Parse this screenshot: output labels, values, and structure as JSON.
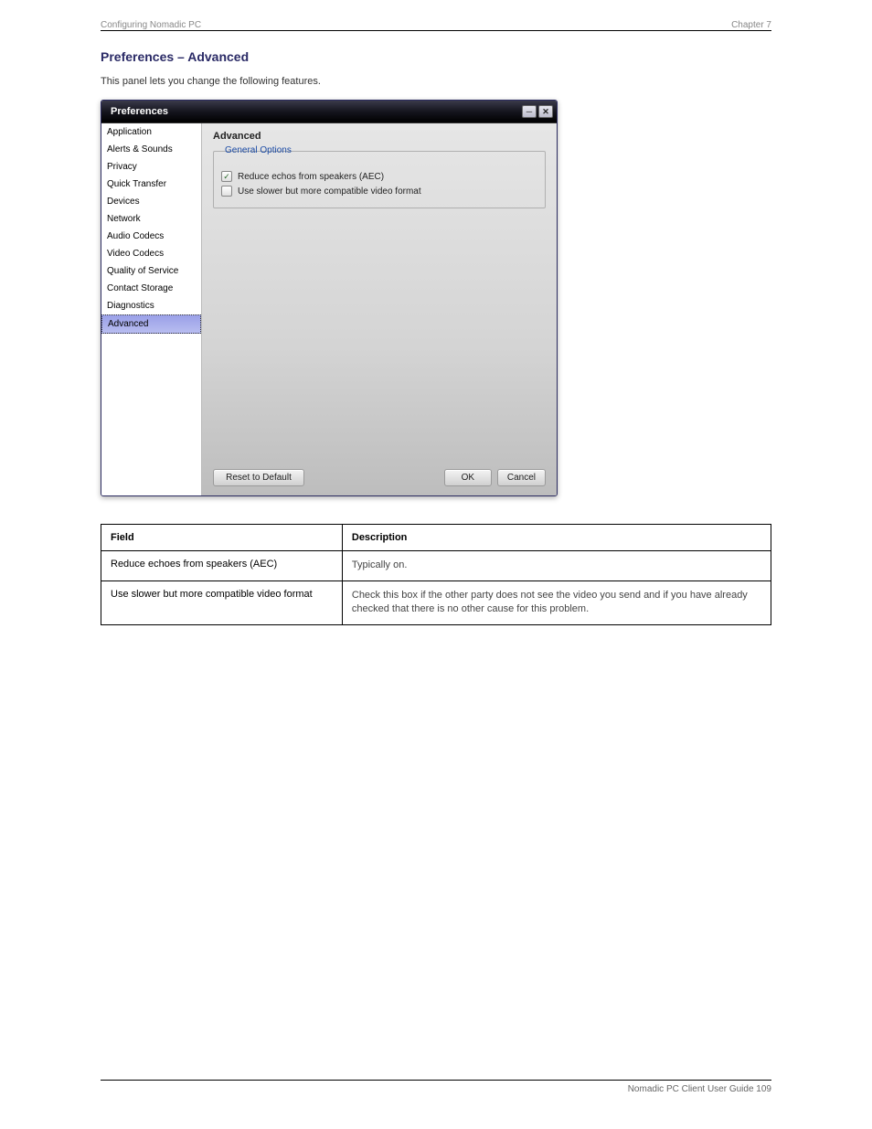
{
  "header": {
    "left": "Configuring Nomadic PC",
    "right": "Chapter 7"
  },
  "section": {
    "heading": "Preferences – Advanced",
    "sub": "This panel lets you change the following features."
  },
  "dialog": {
    "title": "Preferences",
    "panel_title": "Advanced",
    "groupbox_legend": "General Options",
    "checkbox_aec": "Reduce echos from speakers (AEC)",
    "checkbox_video": "Use slower but more compatible video format",
    "btn_reset": "Reset to Default",
    "btn_ok": "OK",
    "btn_cancel": "Cancel"
  },
  "sidebar": {
    "items": [
      "Application",
      "Alerts & Sounds",
      "Privacy",
      "Quick Transfer",
      "Devices",
      "Network",
      "Audio Codecs",
      "Video Codecs",
      "Quality of Service",
      "Contact Storage",
      "Diagnostics",
      "Advanced"
    ]
  },
  "table": {
    "col_field": "Field",
    "col_desc": "Description",
    "rows": [
      {
        "field": "Reduce echoes from speakers (AEC)",
        "desc": "Typically on."
      },
      {
        "field": "Use slower but more compatible video format",
        "desc": "Check this box if the other party does not see the video you send and if you have already checked that there is no other cause for this problem."
      }
    ]
  },
  "footer": {
    "text": "Nomadic PC Client User Guide     109"
  },
  "icons": {
    "minimize": "─",
    "close": "✕",
    "check": "✓"
  }
}
